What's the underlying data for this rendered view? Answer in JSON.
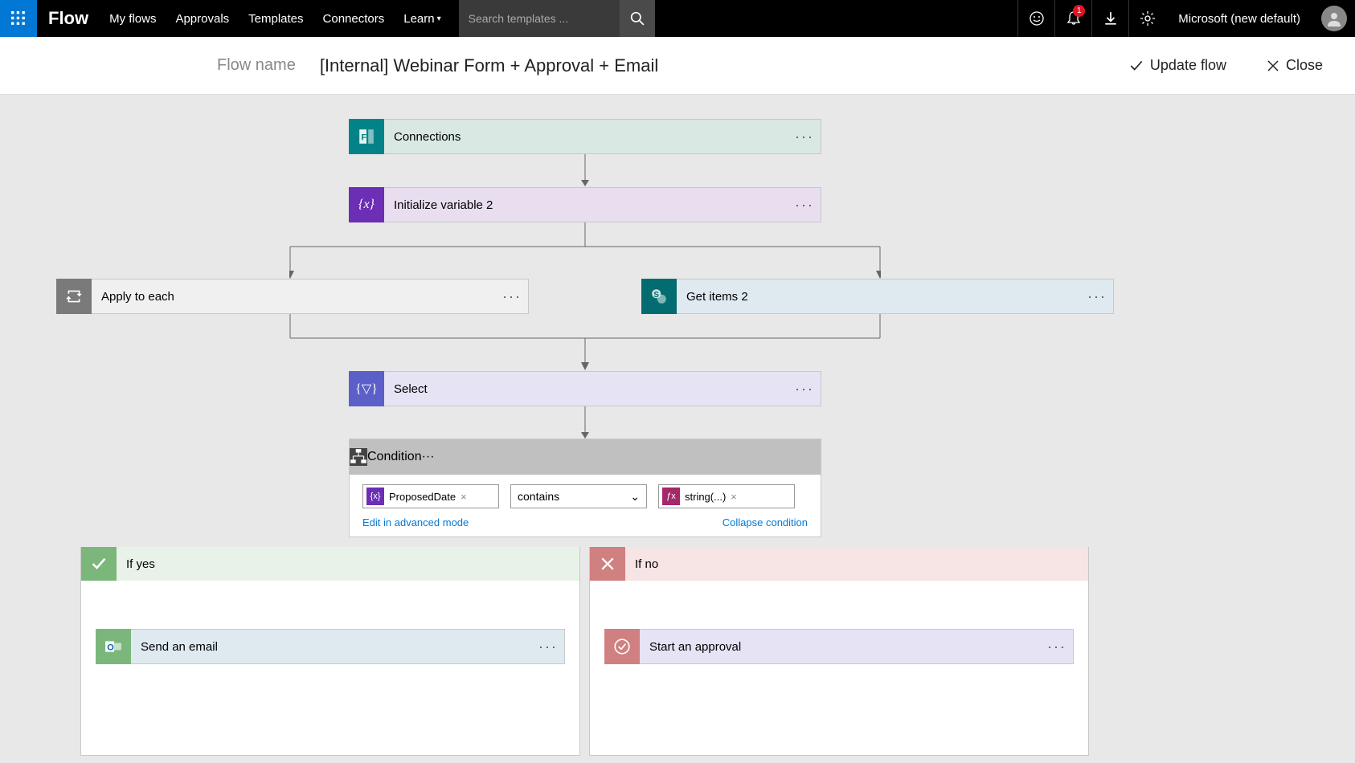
{
  "nav": {
    "brand": "Flow",
    "links": [
      "My flows",
      "Approvals",
      "Templates",
      "Connectors",
      "Learn"
    ],
    "search_placeholder": "Search templates ...",
    "notification_count": "1",
    "tenant": "Microsoft (new default)"
  },
  "header": {
    "label": "Flow name",
    "name": "[Internal] Webinar Form + Approval + Email",
    "update": "Update flow",
    "close": "Close"
  },
  "cards": {
    "connections": "Connections",
    "initvar": "Initialize variable 2",
    "apply": "Apply to each",
    "getitems": "Get items 2",
    "select": "Select",
    "condition": "Condition",
    "sendemail": "Send an email",
    "approval": "Start an approval"
  },
  "condition": {
    "left_token": "ProposedDate",
    "operator": "contains",
    "right_token": "string(...)",
    "edit_link": "Edit in advanced mode",
    "collapse_link": "Collapse condition"
  },
  "branches": {
    "yes": "If yes",
    "no": "If no"
  }
}
